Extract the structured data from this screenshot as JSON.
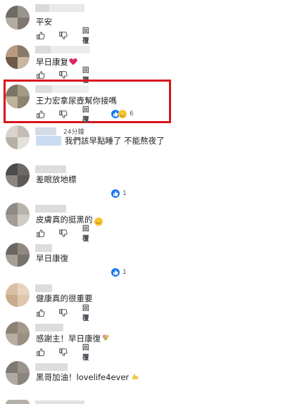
{
  "colors": {
    "accent": "#1877f2",
    "highlight": "#d8141b",
    "text": "#1c1e21"
  },
  "actions": {
    "reply_label": "回覆"
  },
  "comments": [
    {
      "text": "平安"
    },
    {
      "text": "早日康复",
      "emoji": "heart"
    },
    {
      "text": "王力宏拿尿壺幫你接嗎",
      "reactions": {
        "icons": [
          "like-icon",
          "laugh-icon"
        ],
        "count": "6"
      }
    },
    {
      "time": "24分鐘",
      "text": "我們該早點睡了 不能熬夜了"
    },
    {
      "text": "差眼放地標",
      "reactions": {
        "icons": [
          "like-icon"
        ],
        "count": "1"
      }
    },
    {
      "text": "皮膚真的挺黑的",
      "emoji": "laugh"
    },
    {
      "text": "早日康復",
      "reactions": {
        "icons": [
          "like-icon"
        ],
        "count": "1"
      }
    },
    {
      "text": "健康真的很重要"
    },
    {
      "text": "感謝主！早日康復",
      "emoji": "flower"
    },
    {
      "text": "黑哥加油！lovelife4ever",
      "emoji": "muscle"
    }
  ]
}
